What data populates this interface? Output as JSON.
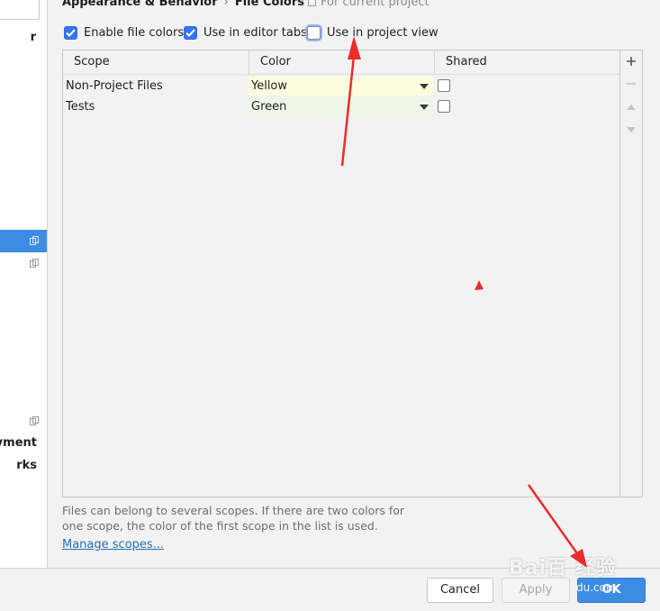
{
  "header": {
    "breadcrumb_parent": "Appearance & Behavior",
    "breadcrumb_separator": "›",
    "breadcrumb_current": "File Colors",
    "scope_note": "For current project"
  },
  "options": {
    "enable_file_colors": {
      "label": "Enable file colors",
      "checked": true
    },
    "use_in_editor_tabs": {
      "label": "Use in editor tabs",
      "checked": true
    },
    "use_in_project_view": {
      "label": "Use in project view",
      "checked": false
    }
  },
  "table": {
    "columns": [
      "Scope",
      "Color",
      "Shared"
    ],
    "rows": [
      {
        "scope": "Non-Project Files",
        "color": "Yellow",
        "color_hex": "#fefde0",
        "shared": false
      },
      {
        "scope": "Tests",
        "color": "Green",
        "color_hex": "#ecf7e6",
        "shared": false
      }
    ]
  },
  "sidebar": {
    "items": [
      {
        "label": "r"
      },
      {
        "label": "oyment"
      },
      {
        "label": "rks"
      }
    ]
  },
  "hint": "Files can belong to several scopes. If there are two colors for one scope, the color of the first scope in the list is used.",
  "manage_scopes": "Manage scopes...",
  "footer": {
    "cancel": "Cancel",
    "apply": "Apply",
    "ok": "OK"
  },
  "watermark": {
    "main": "Bai百 经验",
    "sub": "du.com"
  },
  "colors": {
    "accent": "#3c8ce4",
    "checkbox": "#3574f0",
    "link": "#2470b3",
    "annotation_arrow": "#ee2b2b"
  }
}
